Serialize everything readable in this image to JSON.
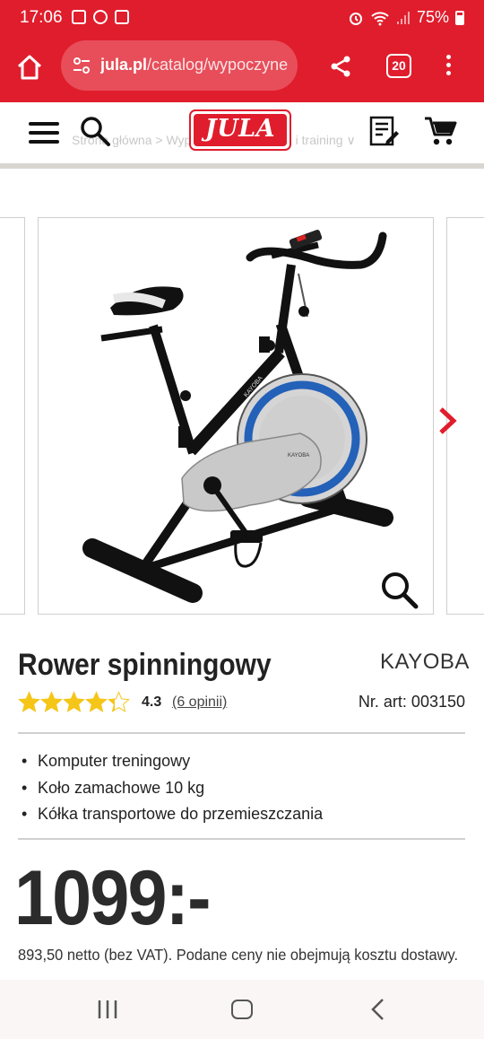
{
  "status_bar": {
    "time": "17:06",
    "battery": "75%",
    "notification_icons": [
      "mail-icon",
      "z-app-icon",
      "image-icon"
    ],
    "right_icons": [
      "alarm-icon",
      "wifi-icon",
      "signal-icon",
      "battery-icon"
    ]
  },
  "browser": {
    "url_host": "jula.pl",
    "url_path": "/catalog/wypoczyne",
    "tab_count": "20",
    "icons": [
      "home-icon",
      "tune-icon",
      "share-icon",
      "tabs-icon",
      "more-vert-icon"
    ]
  },
  "site_header": {
    "logo_text": "JULA",
    "breadcrumb_ghost": "Strona główna   >   Wypoczynek   >   Fitness i training   ∨",
    "icons": [
      "menu-icon",
      "search-icon",
      "shopping-list-icon",
      "cart-icon"
    ]
  },
  "gallery": {
    "image_alt": "KAYOBA spin bike",
    "frame_text": "KAYOBA",
    "icons": [
      "zoom-icon",
      "chevron-right-icon"
    ]
  },
  "product": {
    "title": "Rower spinningowy",
    "brand": "KAYOBA",
    "rating": "4.3",
    "rating_value": 4.3,
    "rating_max": 5,
    "reviews": "(6 opinii)",
    "article_number": "Nr. art: 003150",
    "features": [
      "Komputer treningowy",
      "Koło zamachowe 10 kg",
      "Kółka transportowe do przemieszczania"
    ],
    "price": "1099:-",
    "netto_text": "893,50 netto (bez VAT). Podane ceny nie obejmują kosztu dostawy."
  },
  "colors": {
    "brand_red": "#e01d2c",
    "star_gold": "#f5c518",
    "text_dark": "#222222"
  },
  "nav_bar": {
    "icons": [
      "recent-apps-icon",
      "home-nav-icon",
      "back-icon"
    ]
  }
}
